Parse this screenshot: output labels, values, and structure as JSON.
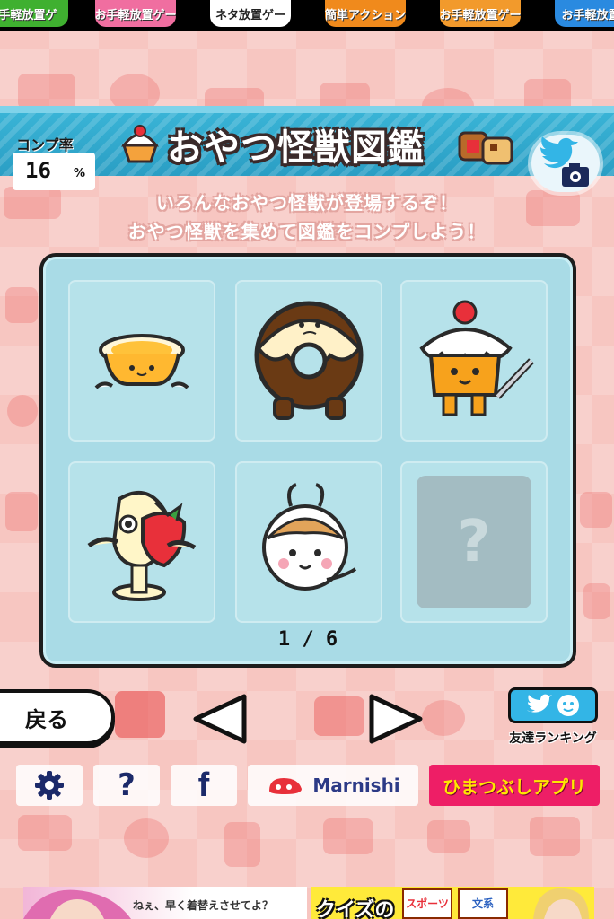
{
  "top_ads": [
    {
      "label": "手軽放置ゲ",
      "color": "#3fb030"
    },
    {
      "label": "お手軽放置ゲー",
      "color": "#f06ea0"
    },
    {
      "label": "ネタ放置ゲー",
      "color": "#ffffff"
    },
    {
      "label": "簡単アクション",
      "color": "#f08a1c"
    },
    {
      "label": "お手軽放置ゲー",
      "color": "#f29a2c"
    },
    {
      "label": "お手軽放置",
      "color": "#2a8ae0"
    }
  ],
  "header": {
    "completion_label": "コンプ率",
    "completion_value": "16",
    "completion_unit": "%",
    "completion_percent": 16,
    "title": "おやつ怪獣図鑑",
    "share_icon": "twitter-camera-icon"
  },
  "subtitle": {
    "line1": "いろんなおやつ怪獣が登場するぞ！",
    "line2": "おやつ怪獣を集めて図鑑をコンプしよう！"
  },
  "collection": {
    "items": [
      {
        "name": "pudding-monster-icon",
        "unlocked": true
      },
      {
        "name": "donut-monster-icon",
        "unlocked": true
      },
      {
        "name": "cake-monster-icon",
        "unlocked": true
      },
      {
        "name": "strawberry-monster-icon",
        "unlocked": true
      },
      {
        "name": "snail-monster-icon",
        "unlocked": true
      },
      {
        "name": "locked-slot",
        "unlocked": false,
        "label": "?"
      }
    ],
    "page_indicator": "1 / 6"
  },
  "nav": {
    "back_label": "戻る",
    "prev_icon": "left-arrow-icon",
    "next_icon": "right-arrow-icon",
    "ranking_label": "友達ランキング"
  },
  "menu": {
    "settings_icon": "gear-icon",
    "help_label": "?",
    "facebook_label": "f",
    "marnishi_label": "Marnishi",
    "himatsubushi_label": "ひまつぶしアプリ"
  },
  "bottom_ads": {
    "left_text": "ねぇ、早く着替えさせてよ？",
    "right_text": "クイズの",
    "tags": [
      "スポーツ",
      "文系"
    ]
  },
  "colors": {
    "background": "#f7c6c1",
    "banner": "#2a9ec4",
    "panel": "#a9dbe6",
    "accent_pink": "#ee1e66",
    "accent_yellow": "#ffe600"
  }
}
